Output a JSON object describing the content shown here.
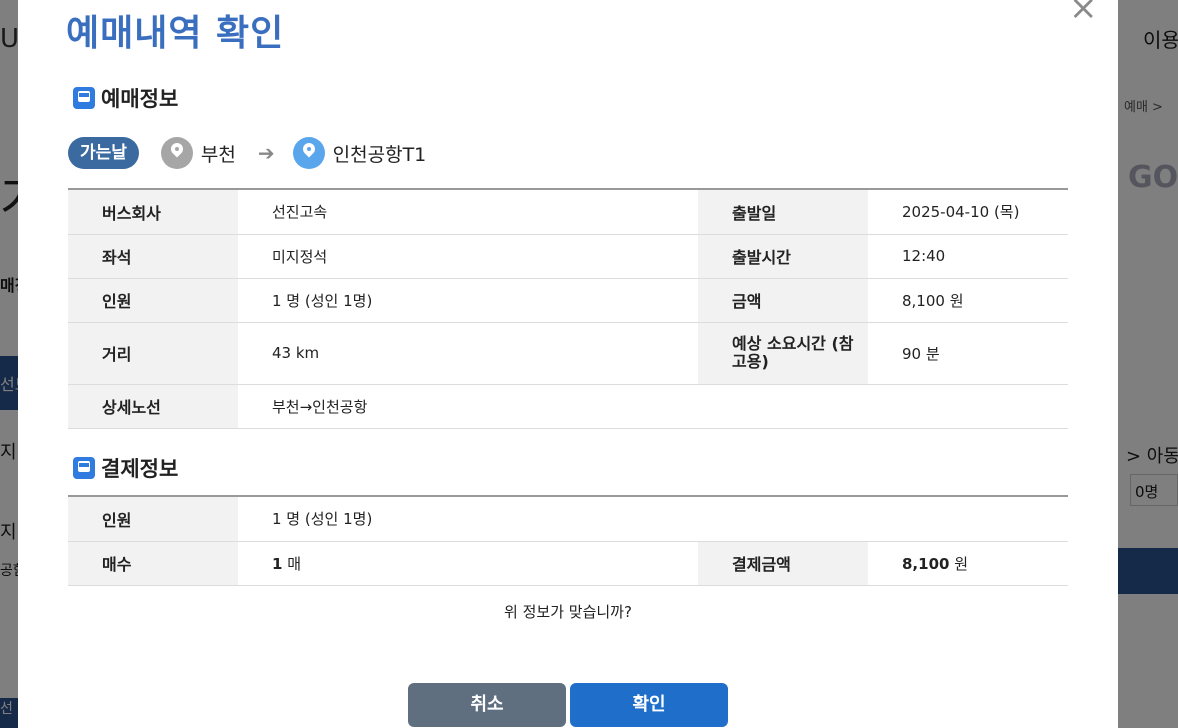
{
  "background": {
    "left_fragments": [
      "US",
      "가",
      "매정",
      "선드",
      "지",
      "지",
      "공함",
      "선"
    ],
    "right_fragments": [
      "이용",
      "예매 >",
      "GO",
      "> 아동",
      "0명"
    ]
  },
  "modal": {
    "title": "예매내역 확인",
    "close_icon": "×",
    "reservation_section": {
      "title": "예매정보",
      "route": {
        "badge": "가는날",
        "origin": "부천",
        "arrow": "➔",
        "destination": "인천공항T1"
      },
      "rows": [
        {
          "label1": "버스회사",
          "value1": "선진고속",
          "label2": "출발일",
          "value2": "2025-04-10 (목)"
        },
        {
          "label1": "좌석",
          "value1": "미지정석",
          "label2": "출발시간",
          "value2": "12:40"
        },
        {
          "label1": "인원",
          "value1": "1 명 (성인 1명)",
          "label2": "금액",
          "value2": "8,100 원"
        },
        {
          "label1": "거리",
          "value1": "43 km",
          "label2": "예상 소요시간 (참고용)",
          "value2": "90 분"
        },
        {
          "label1": "상세노선",
          "value1": "부천→인천공항"
        }
      ]
    },
    "payment_section": {
      "title": "결제정보",
      "rows": [
        {
          "label1": "인원",
          "value1": "1 명 (성인 1명)"
        },
        {
          "label1": "매수",
          "value1_num": "1",
          "value1_unit": " 매",
          "label2": "결제금액",
          "value2_num": "8,100",
          "value2_unit": " 원"
        }
      ]
    },
    "question": "위 정보가 맞습니까?",
    "buttons": {
      "cancel": "취소",
      "ok": "확인"
    }
  },
  "colors": {
    "title": "#3a6fc0",
    "badge": "#3b6aa0",
    "origin_pin": "#a6a6a6",
    "destination_pin": "#5aa6ec",
    "cancel_button": "#5f6f80",
    "ok_button": "#1f6ec9"
  }
}
